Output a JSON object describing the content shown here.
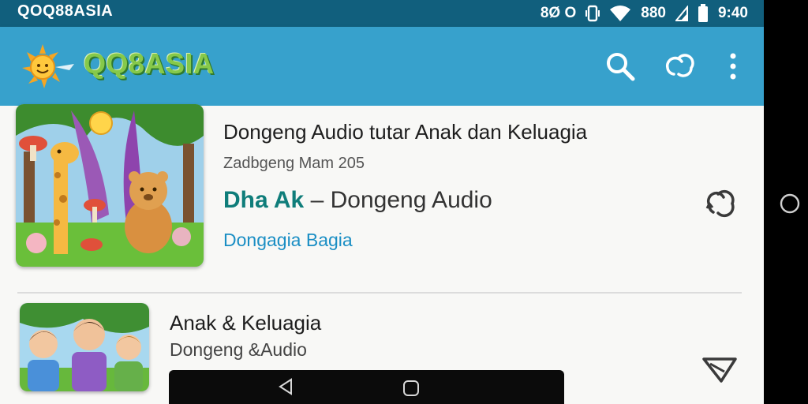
{
  "status": {
    "left_text": "QOQ88ASIA",
    "right_text": "8Ø O",
    "battery_text": "880",
    "time": "9:40"
  },
  "appbar": {
    "title": "QQ8ASIA",
    "icons": [
      "sun-logo-icon",
      "search-icon",
      "sync-icon",
      "more-vert-icon"
    ]
  },
  "items": [
    {
      "title": "Dongeng Audio tutar Anak dan Keluagia",
      "subtitle": "Zadbgeng Mam 205",
      "featured_highlight": "Dha Ak",
      "featured_rest": " – Dongeng Audio",
      "tag": "Dongagia Bagia",
      "action_icon": "sync-icon"
    },
    {
      "title": "Anak & Keluagia",
      "subtitle": "Dongeng &Audio",
      "action_icon": "send-icon"
    }
  ],
  "nav": {
    "icons": [
      "back-icon",
      "home-icon"
    ]
  },
  "colors": {
    "statusbar": "#115f7d",
    "appbar": "#37a1cc",
    "logo_text": "#86c94a",
    "featured_accent": "#0f7d7a",
    "tag": "#1a8ec4"
  }
}
